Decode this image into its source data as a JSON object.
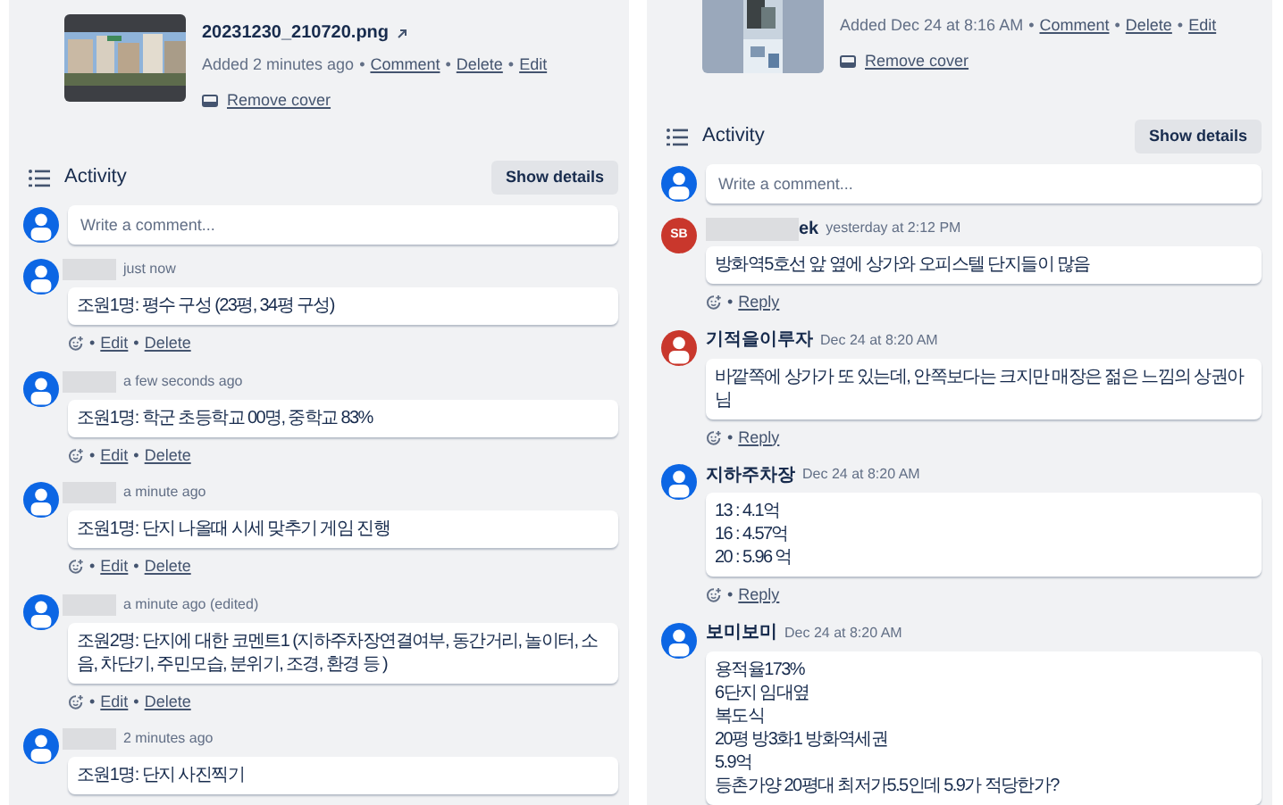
{
  "separator": "•",
  "panels": [
    {
      "attachment": {
        "filename": "20231230_210720.png",
        "added": "Added 2 minutes ago",
        "actions": [
          "Comment",
          "Delete",
          "Edit"
        ],
        "remove_cover": "Remove cover",
        "thumbnail": {
          "kind": "picture"
        }
      },
      "activity": {
        "title": "Activity",
        "show_details": "Show details",
        "placeholder": "Write a comment..."
      },
      "comments": [
        {
          "avatar": {
            "kind": "user"
          },
          "name_redacted": true,
          "time": "just now",
          "lines": [
            "조원1명: 평수 구성 (23평, 34평 구성)"
          ],
          "actions": [
            "Edit",
            "Delete"
          ]
        },
        {
          "avatar": {
            "kind": "user"
          },
          "name_redacted": true,
          "time": "a few seconds ago",
          "lines": [
            "조원1명: 학군 초등학교 00명, 중학교 83%"
          ],
          "actions": [
            "Edit",
            "Delete"
          ]
        },
        {
          "avatar": {
            "kind": "user"
          },
          "name_redacted": true,
          "time": "a minute ago",
          "lines": [
            "조원1명: 단지 나올때 시세 맞추기 게임 진행"
          ],
          "actions": [
            "Edit",
            "Delete"
          ]
        },
        {
          "avatar": {
            "kind": "user"
          },
          "name_redacted": true,
          "time": "a minute ago (edited)",
          "lines": [
            "조원2명: 단지에 대한 코멘트1 (지하주차장연결여부, 동간거리, 놀이터, 소음, 차단기, 주민모습, 분위기, 조경, 환경 등 )"
          ],
          "actions": [
            "Edit",
            "Delete"
          ]
        },
        {
          "avatar": {
            "kind": "user"
          },
          "name_redacted": true,
          "time": "2 minutes ago",
          "lines": [
            "조원1명: 단지 사진찍기"
          ]
        }
      ]
    },
    {
      "attachment": {
        "added": "Added Dec 24 at 8:16 AM",
        "actions": [
          "Comment",
          "Delete",
          "Edit"
        ],
        "remove_cover": "Remove cover",
        "thumbnail": {
          "kind": "picture"
        }
      },
      "activity": {
        "title": "Activity",
        "show_details": "Show details",
        "placeholder": "Write a comment..."
      },
      "comments": [
        {
          "avatar": {
            "kind": "initials",
            "initials": "SB",
            "color": "#c9372c"
          },
          "name_redacted": true,
          "author": "ek",
          "time": "yesterday at 2:12 PM",
          "lines": [
            "방화역5호선 앞 옆에 상가와 오피스텔 단지들이 많음"
          ],
          "actions": [
            "Reply"
          ]
        },
        {
          "avatar": {
            "kind": "user",
            "color": "#c9372c"
          },
          "name_redacted": false,
          "author": "기적을이루자",
          "time": "Dec 24 at 8:20 AM",
          "lines": [
            "바깥쪽에 상가가 또 있는데, 안쪽보다는 크지만 매장은 젊은 느낌의 상권아님"
          ],
          "actions": [
            "Reply"
          ]
        },
        {
          "avatar": {
            "kind": "user"
          },
          "name_redacted": false,
          "author": "지하주차장",
          "time": "Dec 24 at 8:20 AM",
          "lines": [
            "13 : 4.1억",
            "16 : 4.57억",
            "20 : 5.96 억"
          ],
          "actions": [
            "Reply"
          ]
        },
        {
          "avatar": {
            "kind": "user"
          },
          "name_redacted": false,
          "author": "보미보미",
          "time": "Dec 24 at 8:20 AM",
          "lines": [
            "용적율173%",
            "6단지 임대옆",
            "복도식",
            "20평 방3화1 방화역세권",
            "5.9억",
            "등촌가양 20평대 최저가5.5인데 5.9가 적당한가?"
          ]
        }
      ]
    }
  ]
}
